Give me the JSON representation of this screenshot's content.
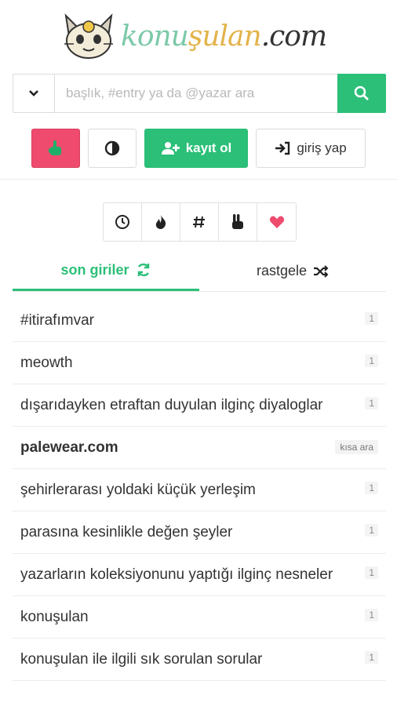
{
  "logo": {
    "part1": "konu",
    "part2": "şulan",
    "part3": ".com"
  },
  "search": {
    "placeholder": "başlık, #entry ya da @yazar ara",
    "dropdown_icon": "chevron-down-icon",
    "button_icon": "search-icon"
  },
  "actions": {
    "register_label": "kayıt ol",
    "login_label": "giriş yap"
  },
  "colors": {
    "accent": "#2bbf78",
    "hand_button": "#ef4b6f",
    "heart": "#ef4b6f"
  },
  "icon_tabs": [
    {
      "icon": "clock-icon"
    },
    {
      "icon": "fire-icon"
    },
    {
      "icon": "hashtag-icon"
    },
    {
      "icon": "peace-hand-icon"
    },
    {
      "icon": "heart-icon"
    }
  ],
  "section_tabs": {
    "recent_label": "son giriler",
    "random_label": "rastgele"
  },
  "topics": [
    {
      "title": "#itirafımvar",
      "count": "1"
    },
    {
      "title": "meowth",
      "count": "1"
    },
    {
      "title": "dışarıdayken etraftan duyulan ilginç diyaloglar",
      "count": "1"
    },
    {
      "title": "palewear.com",
      "badge": "kısa ara"
    },
    {
      "title": "şehirlerarası yoldaki küçük yerleşim",
      "count": "1"
    },
    {
      "title": "parasına kesinlikle değen şeyler",
      "count": "1"
    },
    {
      "title": "yazarların koleksiyonunu yaptığı ilginç nesneler",
      "count": "1"
    },
    {
      "title": "konuşulan",
      "count": "1"
    },
    {
      "title": "konuşulan ile ilgili sık sorulan sorular",
      "count": "1"
    }
  ]
}
